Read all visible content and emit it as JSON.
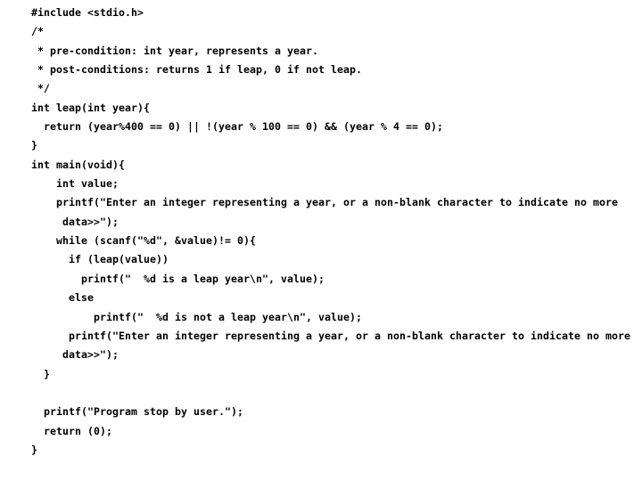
{
  "document": {
    "kind": "source-code-listing",
    "language": "C",
    "background_color": "#ffffff",
    "text_color": "#000000",
    "lines": [
      {
        "id": "line-1",
        "text": "#include <stdio.h>"
      },
      {
        "id": "line-2",
        "text": "/*"
      },
      {
        "id": "line-3",
        "text": " * pre-condition: int year, represents a year."
      },
      {
        "id": "line-4",
        "text": " * post-conditions: returns 1 if leap, 0 if not leap."
      },
      {
        "id": "line-5",
        "text": " */"
      },
      {
        "id": "line-6",
        "text": "int leap(int year){"
      },
      {
        "id": "line-7",
        "text": "  return (year%400 == 0) || !(year % 100 == 0) && (year % 4 == 0);"
      },
      {
        "id": "line-8",
        "text": "}"
      },
      {
        "id": "line-9",
        "text": "int main(void){"
      },
      {
        "id": "line-10",
        "text": "    int value;"
      },
      {
        "id": "line-11",
        "text": "    printf(\"Enter an integer representing a year, or a non-blank character to indicate no more data>>\");"
      },
      {
        "id": "line-12",
        "text": "    while (scanf(\"%d\", &value)!= 0){"
      },
      {
        "id": "line-13",
        "text": "      if (leap(value))"
      },
      {
        "id": "line-14",
        "text": "        printf(\"  %d is a leap year\\n\", value);"
      },
      {
        "id": "line-15",
        "text": "      else"
      },
      {
        "id": "line-16",
        "text": "          printf(\"  %d is not a leap year\\n\", value);"
      },
      {
        "id": "line-17",
        "text": "      printf(\"Enter an integer representing a year, or a non-blank character to indicate no more data>>\");"
      },
      {
        "id": "line-18",
        "text": "  }"
      },
      {
        "id": "line-19",
        "text": ""
      },
      {
        "id": "line-20",
        "text": "  printf(\"Program stop by user.\");"
      },
      {
        "id": "line-21",
        "text": "  return (0);"
      },
      {
        "id": "line-22",
        "text": "}"
      }
    ]
  }
}
